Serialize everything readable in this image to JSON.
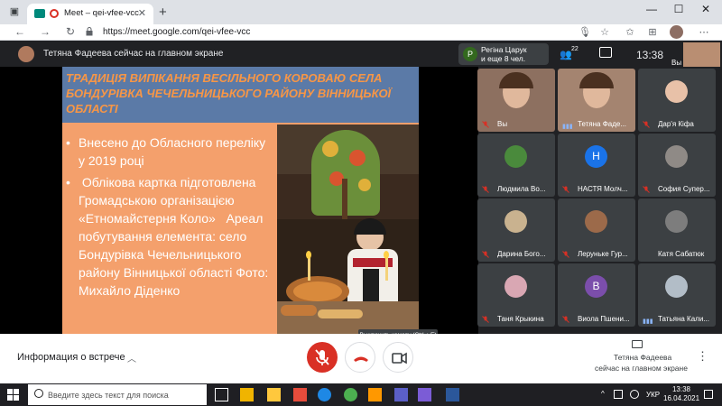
{
  "browser": {
    "tab_title": "Meet – qei-vfee-vcc",
    "tab_close": "✕",
    "new_tab": "+",
    "url": "https://meet.google.com/qei-vfee-vcc",
    "window_min": "—",
    "window_max": "☐",
    "window_close": "✕"
  },
  "header": {
    "presenter_title": "Тетяна Фадеева сейчас на главном экране",
    "notification_line1": "Регіна Царук",
    "notification_line2": "и еще 8 чел.",
    "notification_avatar": "Р",
    "people_count": "22",
    "clock": "13:38",
    "self_label": "Вы"
  },
  "slide": {
    "title": "ТРАДИЦІЯ ВИПІКАННЯ ВЕСІЛЬНОГО КОРОВАЮ СЕЛА БОНДУРІВКА ЧЕЧЕЛЬНИЦЬКОГО РАЙОНУ ВІННИЦЬКОЇ ОБЛАСТІ",
    "bullets": [
      "Внесено до Обласного переліку у 2019 році",
      " Облікова картка підготовлена Громадською організацією «Етномайстерня Коло»   Ареал побутування елемента: село Бондурівка Чечельницького району Вінницької області Фото: Михайло Діденко"
    ],
    "bullet_mark": "•",
    "colors": {
      "background": "#f4a06c",
      "title_bar": "#5b7aa7",
      "title_text": "#f79646"
    }
  },
  "tooltip": {
    "camera": "Выключить камеру (Ctrl + E)"
  },
  "participants": [
    {
      "name": "Вы",
      "type": "video",
      "color": "#8d7060",
      "muted": true
    },
    {
      "name": "Тетяна Фаде...",
      "type": "video",
      "color": "#a48470",
      "muted": false,
      "speaking": true
    },
    {
      "name": "Дар'я Кіфа",
      "type": "avatar",
      "color": "#e8c1a8",
      "muted": true
    },
    {
      "name": "Людмила Во...",
      "type": "avatar",
      "color": "#4a8a3c",
      "muted": true
    },
    {
      "name": "НАСТЯ Молч...",
      "type": "letter",
      "letter": "Н",
      "color": "#1a73e8",
      "muted": true
    },
    {
      "name": "София Супер...",
      "type": "avatar",
      "color": "#8f8a86",
      "muted": true
    },
    {
      "name": "Дарина Бого...",
      "type": "avatar",
      "color": "#c9b28f",
      "muted": true
    },
    {
      "name": "Леруньке Гур...",
      "type": "avatar",
      "color": "#9c6a4a",
      "muted": true
    },
    {
      "name": "Катя Сабатюк",
      "type": "avatar",
      "color": "#7d7d7d",
      "muted": false
    },
    {
      "name": "Таня Крыкина",
      "type": "avatar",
      "color": "#d9a7b3",
      "muted": true
    },
    {
      "name": "Виола Пшени...",
      "type": "letter",
      "letter": "В",
      "color": "#7b4eab",
      "muted": true
    },
    {
      "name": "Татьяна Кали...",
      "type": "avatar",
      "color": "#b2bdc7",
      "muted": false,
      "speaking": true
    }
  ],
  "bottombar": {
    "meeting_info": "Информация о встрече",
    "presenter_line1": "Тетяна Фадеева",
    "presenter_line2": "сейчас на главном экране"
  },
  "taskbar": {
    "search_placeholder": "Введите здесь текст для поиска",
    "lang": "УКР",
    "time": "13:38",
    "date": "16.04.2021"
  },
  "colors": {
    "mic_off_red": "#d93025",
    "meet_dark": "#202124",
    "tile": "#3c4043",
    "accent_blue": "#8ab4f8"
  },
  "icons": {
    "mic_off": "mic-off-icon",
    "end_call": "phone-hangup-icon",
    "camera": "video-camera-icon",
    "people": "people-icon",
    "chat": "chat-icon",
    "present": "present-screen-icon",
    "more": "more-vert-icon"
  }
}
